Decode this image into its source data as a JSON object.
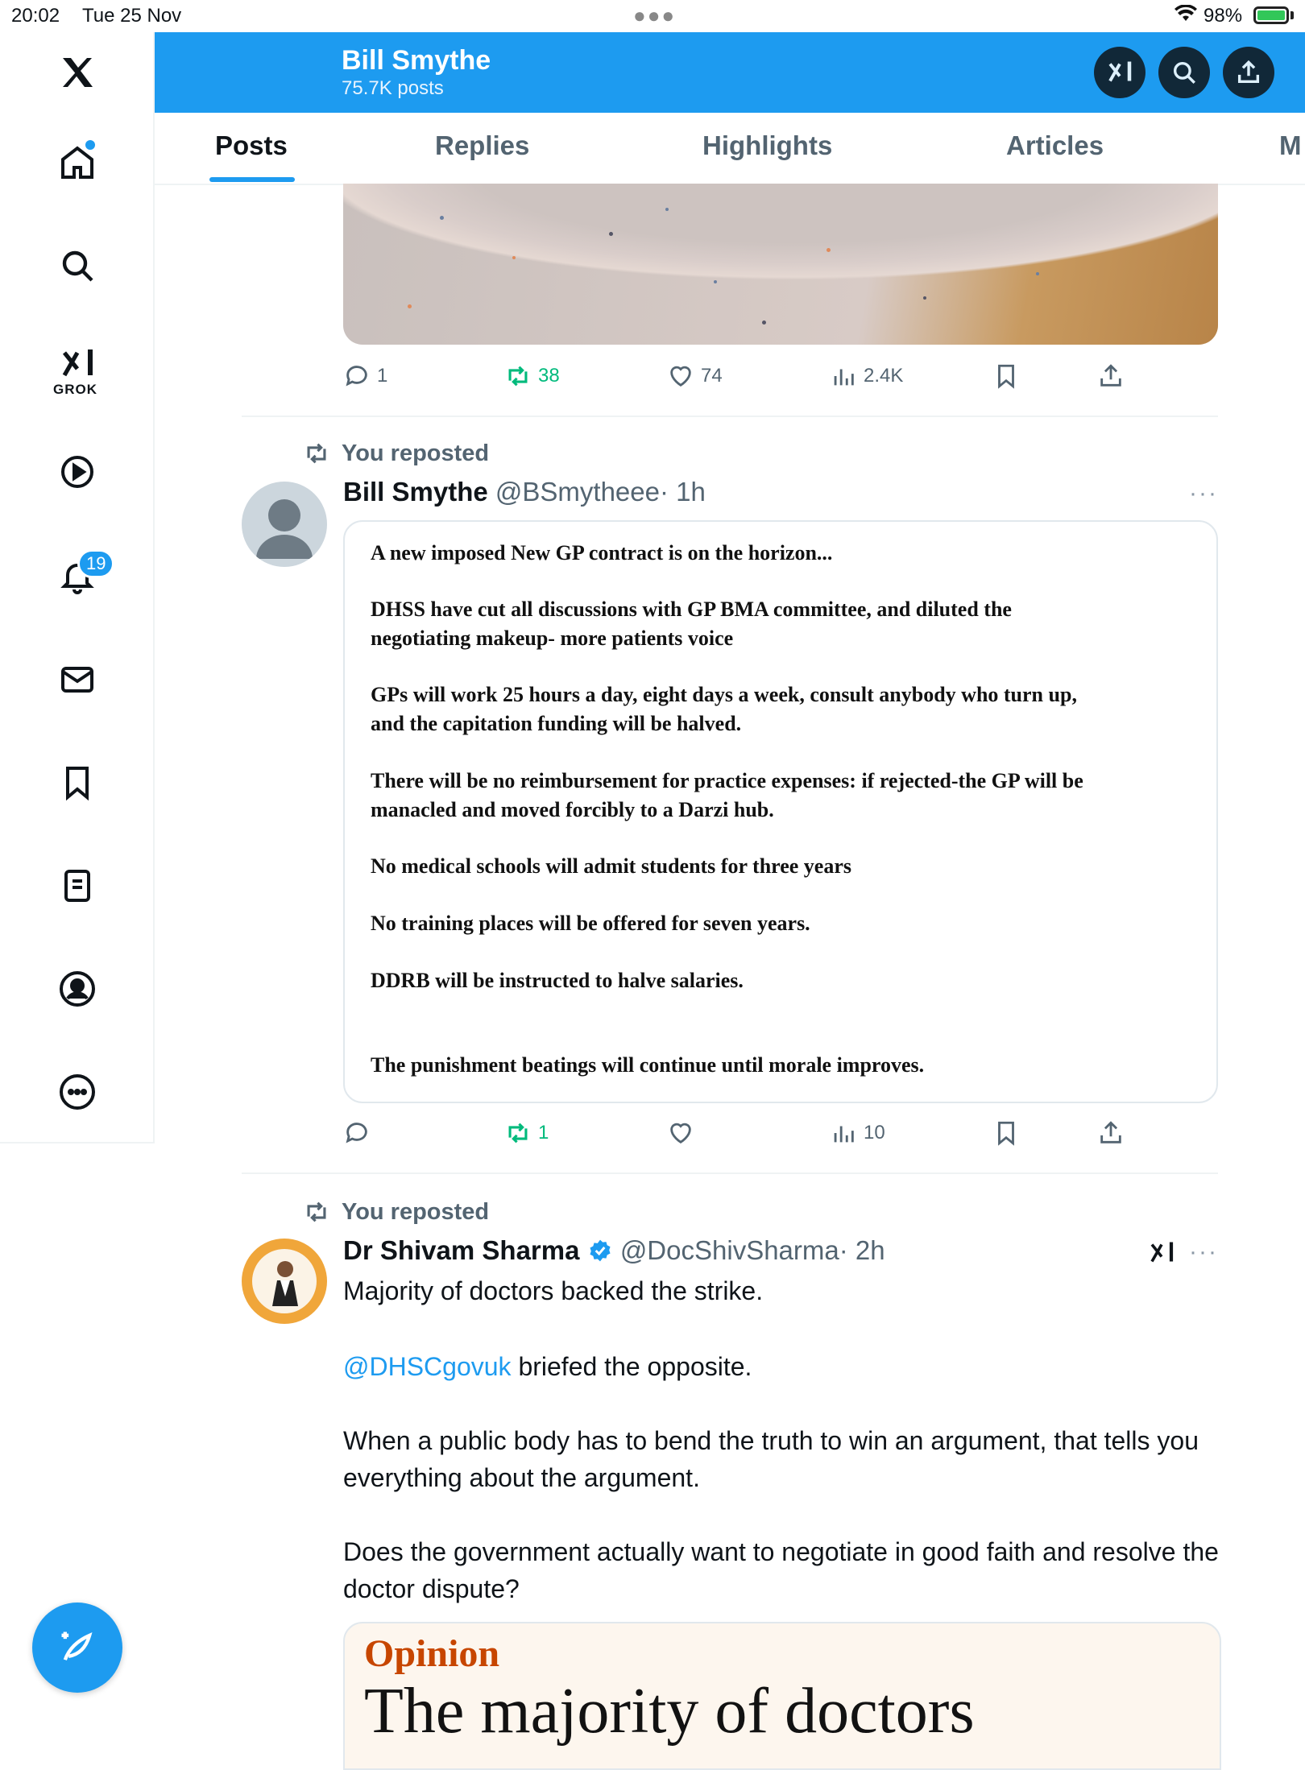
{
  "status_bar": {
    "time": "20:02",
    "date": "Tue 25 Nov",
    "battery": "98%"
  },
  "sidebar": {
    "notifications_badge": "19",
    "grok_label": "GROK"
  },
  "header": {
    "name": "Bill Smythe",
    "posts_count": "75.7K posts"
  },
  "tabs": [
    {
      "label": "Posts"
    },
    {
      "label": "Replies"
    },
    {
      "label": "Highlights"
    },
    {
      "label": "Articles"
    },
    {
      "label": "M"
    }
  ],
  "post1": {
    "actions": {
      "replies": "1",
      "reposts": "38",
      "likes": "74",
      "views": "2.4K"
    }
  },
  "post2": {
    "repost_label": "You reposted",
    "name": "Bill Smythe",
    "handle": "@BSmytheee",
    "time": "· 1h",
    "image_text": [
      "A new imposed New GP contract is on the horizon...",
      "DHSS have cut all discussions with GP BMA committee, and diluted the",
      "negotiating makeup- more patients voice",
      "GPs will work 25 hours a day, eight days a week, consult anybody who turn up,",
      "and the capitation funding will be halved.",
      "There will be no reimbursement for practice expenses: if rejected-the GP will be",
      "manacled and moved forcibly to a Darzi hub.",
      "No medical schools will admit students for three years",
      "No training places will be offered for seven years.",
      "DDRB will be instructed to halve salaries.",
      "The punishment beatings will continue until morale improves."
    ],
    "actions": {
      "reposts": "1",
      "views": "10"
    }
  },
  "post3": {
    "repost_label": "You reposted",
    "name": "Dr Shivam Sharma",
    "handle": "@DocShivSharma",
    "time": "· 2h",
    "text": {
      "p1": "Majority of doctors backed the strike.",
      "p2_mention": "@DHSCgovuk",
      "p2_rest": " briefed the opposite.",
      "p3": "When a public body has to bend the truth to win an argument, that tells you everything about the argument.",
      "p4": "Does the government actually want to negotiate in good faith and resolve the doctor dispute?"
    },
    "article": {
      "kicker": "Opinion",
      "title": "The majority of doctors"
    }
  },
  "colors": {
    "accent": "#1d9bf0",
    "repost_green": "#00ba7c",
    "muted": "#536471"
  }
}
